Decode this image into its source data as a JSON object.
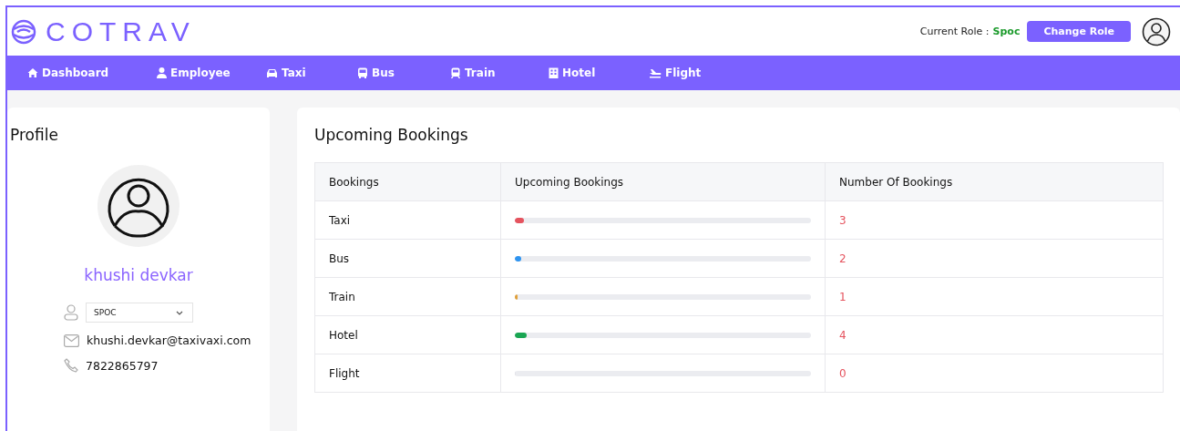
{
  "header": {
    "logo": "COTRAV",
    "role_label": "Current Role :",
    "role_value": "Spoc",
    "change_role_button": "Change Role"
  },
  "nav": [
    {
      "label": "Dashboard",
      "kind": "home"
    },
    {
      "label": "Employee",
      "kind": "person"
    },
    {
      "label": "Taxi",
      "kind": "car"
    },
    {
      "label": "Bus",
      "kind": "bus"
    },
    {
      "label": "Train",
      "kind": "train"
    },
    {
      "label": "Hotel",
      "kind": "hotel"
    },
    {
      "label": "Flight",
      "kind": "plane"
    }
  ],
  "profile": {
    "title": "Profile",
    "name": "khushi devkar",
    "role_select": "SPOC",
    "email": "khushi.devkar@taxivaxi.com",
    "phone": "7822865797"
  },
  "bookings": {
    "title": "Upcoming Bookings",
    "columns": [
      "Bookings",
      "Upcoming Bookings",
      "Number Of Bookings"
    ],
    "rows": [
      {
        "name": "Taxi",
        "level": 0.03,
        "color": "#e5535e",
        "count": "3"
      },
      {
        "name": "Bus",
        "level": 0.02,
        "color": "#2f94f0",
        "count": "2"
      },
      {
        "name": "Train",
        "level": 0.01,
        "color": "#e0a03a",
        "count": "1"
      },
      {
        "name": "Hotel",
        "level": 0.04,
        "color": "#1aa653",
        "count": "4"
      },
      {
        "name": "Flight",
        "level": 0,
        "count": "0"
      }
    ]
  }
}
